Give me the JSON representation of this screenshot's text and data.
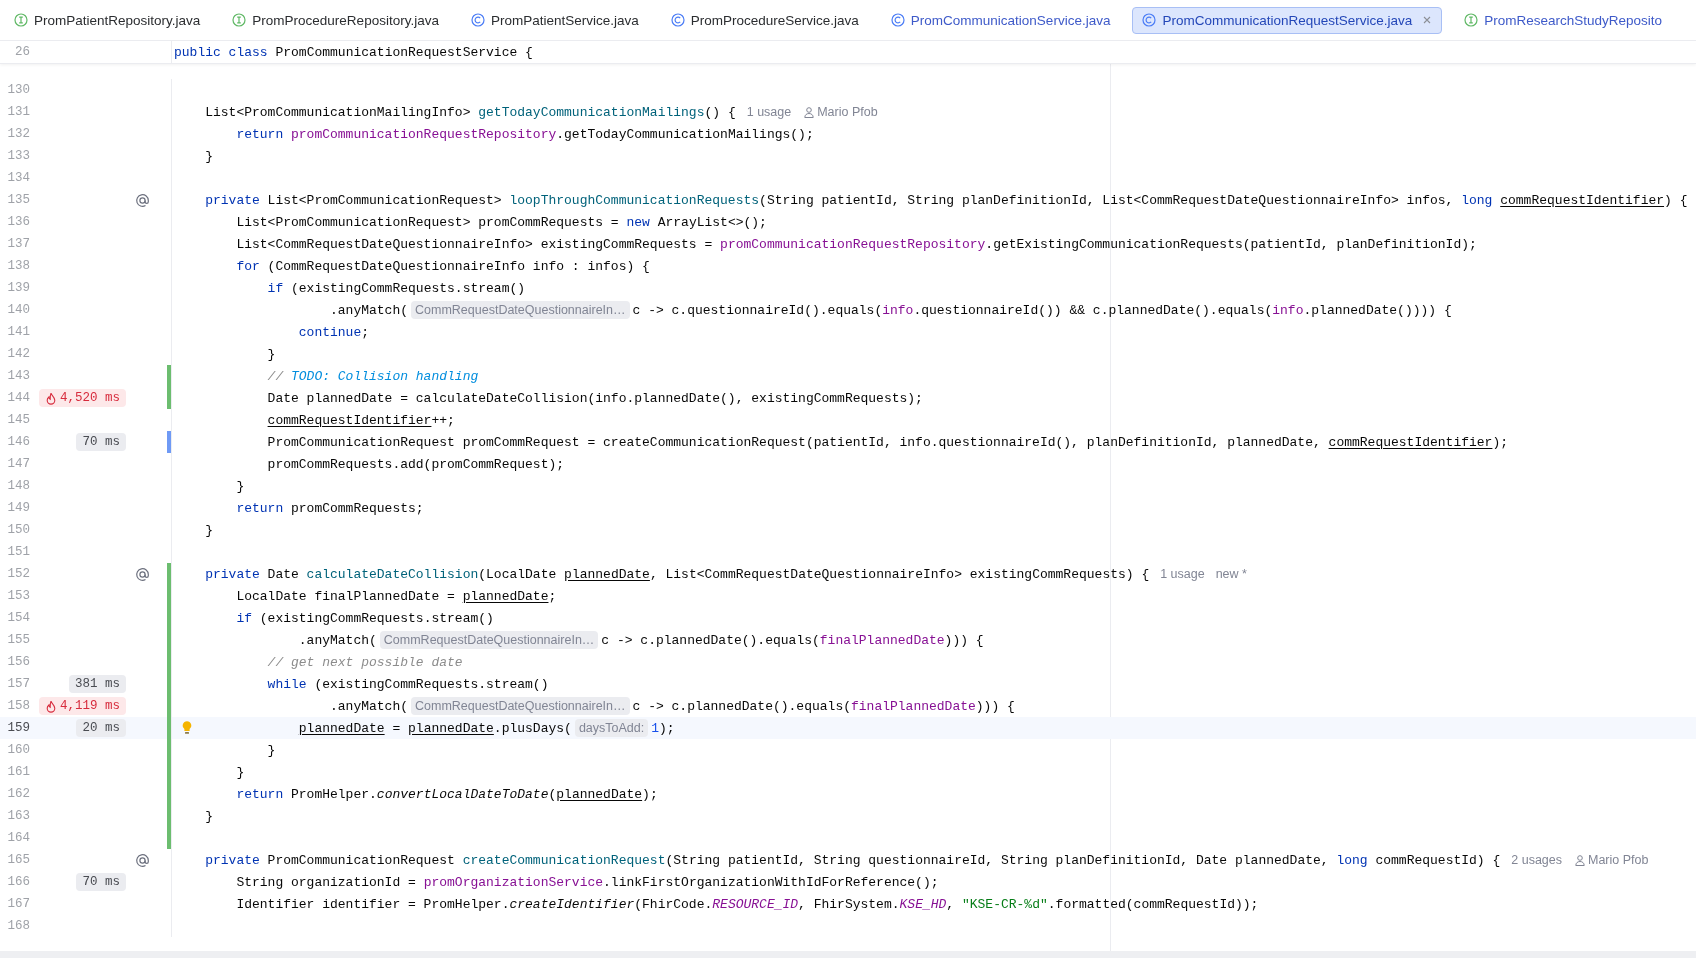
{
  "tabs": [
    {
      "label": "PromPatientRepository.java",
      "kind": "interface",
      "modified": false,
      "selected": false
    },
    {
      "label": "PromProcedureRepository.java",
      "kind": "interface",
      "modified": false,
      "selected": false
    },
    {
      "label": "PromPatientService.java",
      "kind": "class",
      "modified": false,
      "selected": false
    },
    {
      "label": "PromProcedureService.java",
      "kind": "class",
      "modified": false,
      "selected": false
    },
    {
      "label": "PromCommunicationService.java",
      "kind": "class",
      "modified": true,
      "selected": false
    },
    {
      "label": "PromCommunicationRequestService.java",
      "kind": "class",
      "modified": true,
      "selected": true
    },
    {
      "label": "PromResearchStudyReposito",
      "kind": "interface",
      "modified": true,
      "selected": false
    }
  ],
  "editor": {
    "sticky_line": {
      "number": "26",
      "code": [
        {
          "kind": "keyword",
          "text": "public class"
        },
        {
          "kind": "plain",
          "text": " PromCommunicationRequestService {"
        }
      ]
    },
    "lines": [
      {
        "number": "130",
        "current": false
      },
      {
        "number": "131",
        "current": false,
        "code": [
          {
            "kind": "plain",
            "text": "    List<PromCommunicationMailingInfo> "
          },
          {
            "kind": "declaration",
            "text": "getTodayCommunicationMailings"
          },
          {
            "kind": "plain",
            "text": "() {"
          },
          {
            "kind": "usage",
            "text": "1 usage"
          },
          {
            "kind": "author",
            "text": "Mario Pfob"
          }
        ]
      },
      {
        "number": "132",
        "current": false,
        "code": [
          {
            "kind": "keyword",
            "text": "        return "
          },
          {
            "kind": "field",
            "text": "promCommunicationRequestRepository"
          },
          {
            "kind": "plain",
            "text": ".getTodayCommunicationMailings();"
          }
        ]
      },
      {
        "number": "133",
        "current": false,
        "code": [
          {
            "kind": "plain",
            "text": "    }"
          }
        ]
      },
      {
        "number": "134",
        "current": false
      },
      {
        "number": "135",
        "current": false,
        "gutter_icon": {
          "kind": "at"
        },
        "code": [
          {
            "kind": "keyword",
            "text": "    private"
          },
          {
            "kind": "plain",
            "text": " List<PromCommunicationRequest> "
          },
          {
            "kind": "declaration",
            "text": "loopThroughCommunicationRequests"
          },
          {
            "kind": "plain",
            "text": "(String patientId, String planDefinitionId, List<CommRequestDateQuestionnaireInfo> infos, "
          },
          {
            "kind": "keyword",
            "text": "long "
          },
          {
            "kind": "underline",
            "text": "commRequestIdentifier"
          },
          {
            "kind": "plain",
            "text": ") {"
          }
        ]
      },
      {
        "number": "136",
        "current": false,
        "code": [
          {
            "kind": "plain",
            "text": "        List<PromCommunicationRequest> promCommRequests = "
          },
          {
            "kind": "keyword",
            "text": "new"
          },
          {
            "kind": "plain",
            "text": " ArrayList<>();"
          }
        ]
      },
      {
        "number": "137",
        "current": false,
        "code": [
          {
            "kind": "plain",
            "text": "        List<CommRequestDateQuestionnaireInfo> existingCommRequests = "
          },
          {
            "kind": "field",
            "text": "promCommunicationRequestRepository"
          },
          {
            "kind": "plain",
            "text": ".getExistingCommunicationRequests(patientId, planDefinitionId);"
          }
        ]
      },
      {
        "number": "138",
        "current": false,
        "code": [
          {
            "kind": "keyword",
            "text": "        for"
          },
          {
            "kind": "plain",
            "text": " (CommRequestDateQuestionnaireInfo info : infos) {"
          }
        ]
      },
      {
        "number": "139",
        "current": false,
        "code": [
          {
            "kind": "keyword",
            "text": "            if"
          },
          {
            "kind": "plain",
            "text": " (existingCommRequests.stream()"
          }
        ]
      },
      {
        "number": "140",
        "current": false,
        "code": [
          {
            "kind": "plain",
            "text": "                    .anyMatch("
          },
          {
            "kind": "hint",
            "text": "CommRequestDateQuestionnaireIn…"
          },
          {
            "kind": "plain",
            "text": "c -> c.questionnaireId().equals("
          },
          {
            "kind": "field",
            "text": "info"
          },
          {
            "kind": "plain",
            "text": ".questionnaireId()) && c.plannedDate().equals("
          },
          {
            "kind": "field",
            "text": "info"
          },
          {
            "kind": "plain",
            "text": ".plannedDate()))) {"
          }
        ]
      },
      {
        "number": "141",
        "current": false,
        "code": [
          {
            "kind": "keyword",
            "text": "                continue"
          },
          {
            "kind": "plain",
            "text": ";"
          }
        ]
      },
      {
        "number": "142",
        "current": false,
        "code": [
          {
            "kind": "plain",
            "text": "            }"
          }
        ]
      },
      {
        "number": "143",
        "current": false,
        "change": {
          "kind": "added"
        },
        "code": [
          {
            "kind": "comment",
            "text": "            // "
          },
          {
            "kind": "todo",
            "text": "TODO: Collision handling"
          }
        ]
      },
      {
        "number": "144",
        "current": false,
        "change": {
          "kind": "added"
        },
        "timing": {
          "text": "4,520 ms",
          "hot": true
        },
        "code": [
          {
            "kind": "plain",
            "text": "            Date plannedDate = calculateDateCollision(info.plannedDate(), existingCommRequests);"
          }
        ]
      },
      {
        "number": "145",
        "current": false,
        "code": [
          {
            "kind": "underline",
            "text": "            commRequestIdentifier"
          },
          {
            "kind": "plain",
            "text": "++;"
          }
        ]
      },
      {
        "number": "146",
        "current": false,
        "change": {
          "kind": "modified"
        },
        "timing": {
          "text": "70 ms",
          "hot": false
        },
        "code": [
          {
            "kind": "plain",
            "text": "            PromCommunicationRequest promCommRequest = createCommunicationRequest(patientId, info.questionnaireId(), planDefinitionId, plannedDate, "
          },
          {
            "kind": "underline",
            "text": "commRequestIdentifier"
          },
          {
            "kind": "plain",
            "text": ");"
          }
        ]
      },
      {
        "number": "147",
        "current": false,
        "code": [
          {
            "kind": "plain",
            "text": "            promCommRequests.add(promCommRequest);"
          }
        ]
      },
      {
        "number": "148",
        "current": false,
        "code": [
          {
            "kind": "plain",
            "text": "        }"
          }
        ]
      },
      {
        "number": "149",
        "current": false,
        "code": [
          {
            "kind": "keyword",
            "text": "        return"
          },
          {
            "kind": "plain",
            "text": " promCommRequests;"
          }
        ]
      },
      {
        "number": "150",
        "current": false,
        "code": [
          {
            "kind": "plain",
            "text": "    }"
          }
        ]
      },
      {
        "number": "151",
        "current": false
      },
      {
        "number": "152",
        "current": false,
        "gutter_icon": {
          "kind": "at"
        },
        "change": {
          "kind": "added"
        },
        "code": [
          {
            "kind": "keyword",
            "text": "    private"
          },
          {
            "kind": "plain",
            "text": " Date "
          },
          {
            "kind": "declaration",
            "text": "calculateDateCollision"
          },
          {
            "kind": "plain",
            "text": "(LocalDate "
          },
          {
            "kind": "underline",
            "text": "plannedDate"
          },
          {
            "kind": "plain",
            "text": ", List<CommRequestDateQuestionnaireInfo> existingCommRequests) {"
          },
          {
            "kind": "usage",
            "text": "1 usage"
          },
          {
            "kind": "usage",
            "text": "new *"
          }
        ]
      },
      {
        "number": "153",
        "current": false,
        "change": {
          "kind": "added"
        },
        "code": [
          {
            "kind": "plain",
            "text": "        LocalDate finalPlannedDate = "
          },
          {
            "kind": "underline",
            "text": "plannedDate"
          },
          {
            "kind": "plain",
            "text": ";"
          }
        ]
      },
      {
        "number": "154",
        "current": false,
        "change": {
          "kind": "added"
        },
        "code": [
          {
            "kind": "keyword",
            "text": "        if"
          },
          {
            "kind": "plain",
            "text": " (existingCommRequests.stream()"
          }
        ]
      },
      {
        "number": "155",
        "current": false,
        "change": {
          "kind": "added"
        },
        "code": [
          {
            "kind": "plain",
            "text": "                .anyMatch("
          },
          {
            "kind": "hint",
            "text": "CommRequestDateQuestionnaireIn…"
          },
          {
            "kind": "plain",
            "text": "c -> c.plannedDate().equals("
          },
          {
            "kind": "field",
            "text": "finalPlannedDate"
          },
          {
            "kind": "plain",
            "text": "))) {"
          }
        ]
      },
      {
        "number": "156",
        "current": false,
        "change": {
          "kind": "added"
        },
        "code": [
          {
            "kind": "comment",
            "text": "            // get next possible date"
          }
        ]
      },
      {
        "number": "157",
        "current": false,
        "change": {
          "kind": "added"
        },
        "timing": {
          "text": "381 ms",
          "hot": false
        },
        "code": [
          {
            "kind": "keyword",
            "text": "            while"
          },
          {
            "kind": "plain",
            "text": " (existingCommRequests.stream()"
          }
        ]
      },
      {
        "number": "158",
        "current": false,
        "change": {
          "kind": "added"
        },
        "timing": {
          "text": "4,119 ms",
          "hot": true
        },
        "code": [
          {
            "kind": "plain",
            "text": "                    .anyMatch("
          },
          {
            "kind": "hint",
            "text": "CommRequestDateQuestionnaireIn…"
          },
          {
            "kind": "plain",
            "text": "c -> c.plannedDate().equals("
          },
          {
            "kind": "field",
            "text": "finalPlannedDate"
          },
          {
            "kind": "plain",
            "text": "))) {"
          }
        ]
      },
      {
        "number": "159",
        "current": true,
        "change": {
          "kind": "added"
        },
        "gutter_icon": {
          "kind": "bulb"
        },
        "timing": {
          "text": "20 ms",
          "hot": false
        },
        "code": [
          {
            "kind": "underline",
            "text": "                plannedDate"
          },
          {
            "kind": "plain",
            "text": " = "
          },
          {
            "kind": "underline",
            "text": "plannedDate"
          },
          {
            "kind": "plain",
            "text": ".plusDays("
          },
          {
            "kind": "hint",
            "text": "daysToAdd:"
          },
          {
            "kind": "number",
            "text": "1"
          },
          {
            "kind": "plain",
            "text": ");"
          }
        ]
      },
      {
        "number": "160",
        "current": false,
        "change": {
          "kind": "added"
        },
        "code": [
          {
            "kind": "plain",
            "text": "            }"
          }
        ]
      },
      {
        "number": "161",
        "current": false,
        "change": {
          "kind": "added"
        },
        "code": [
          {
            "kind": "plain",
            "text": "        }"
          }
        ]
      },
      {
        "number": "162",
        "current": false,
        "change": {
          "kind": "added"
        },
        "code": [
          {
            "kind": "keyword",
            "text": "        return"
          },
          {
            "kind": "plain",
            "text": " PromHelper."
          },
          {
            "kind": "italic",
            "text": "convertLocalDateToDate"
          },
          {
            "kind": "plain",
            "text": "("
          },
          {
            "kind": "underline",
            "text": "plannedDate"
          },
          {
            "kind": "plain",
            "text": ");"
          }
        ]
      },
      {
        "number": "163",
        "current": false,
        "change": {
          "kind": "added"
        },
        "code": [
          {
            "kind": "plain",
            "text": "    }"
          }
        ]
      },
      {
        "number": "164",
        "current": false,
        "change": {
          "kind": "added"
        }
      },
      {
        "number": "165",
        "current": false,
        "gutter_icon": {
          "kind": "at"
        },
        "code": [
          {
            "kind": "keyword",
            "text": "    private"
          },
          {
            "kind": "plain",
            "text": " PromCommunicationRequest "
          },
          {
            "kind": "declaration",
            "text": "createCommunicationRequest"
          },
          {
            "kind": "plain",
            "text": "(String patientId, String questionnaireId, String planDefinitionId, Date plannedDate, "
          },
          {
            "kind": "keyword",
            "text": "long"
          },
          {
            "kind": "plain",
            "text": " commRequestId) {"
          },
          {
            "kind": "usage",
            "text": "2 usages"
          },
          {
            "kind": "author",
            "text": "Mario Pfob"
          }
        ]
      },
      {
        "number": "166",
        "current": false,
        "timing": {
          "text": "70 ms",
          "hot": false
        },
        "code": [
          {
            "kind": "plain",
            "text": "        String organizationId = "
          },
          {
            "kind": "field",
            "text": "promOrganizationService"
          },
          {
            "kind": "plain",
            "text": ".linkFirstOrganizationWithIdForReference();"
          }
        ]
      },
      {
        "number": "167",
        "current": false,
        "code": [
          {
            "kind": "plain",
            "text": "        Identifier identifier = PromHelper."
          },
          {
            "kind": "italic",
            "text": "createIdentifier"
          },
          {
            "kind": "plain",
            "text": "(FhirCode."
          },
          {
            "kind": "static",
            "text": "RESOURCE_ID"
          },
          {
            "kind": "plain",
            "text": ", FhirSystem."
          },
          {
            "kind": "static",
            "text": "KSE_HD"
          },
          {
            "kind": "plain",
            "text": ", "
          },
          {
            "kind": "string",
            "text": "\"KSE-CR-%d\""
          },
          {
            "kind": "plain",
            "text": ".formatted(commRequestId));"
          }
        ]
      },
      {
        "number": "168",
        "current": false
      }
    ]
  }
}
